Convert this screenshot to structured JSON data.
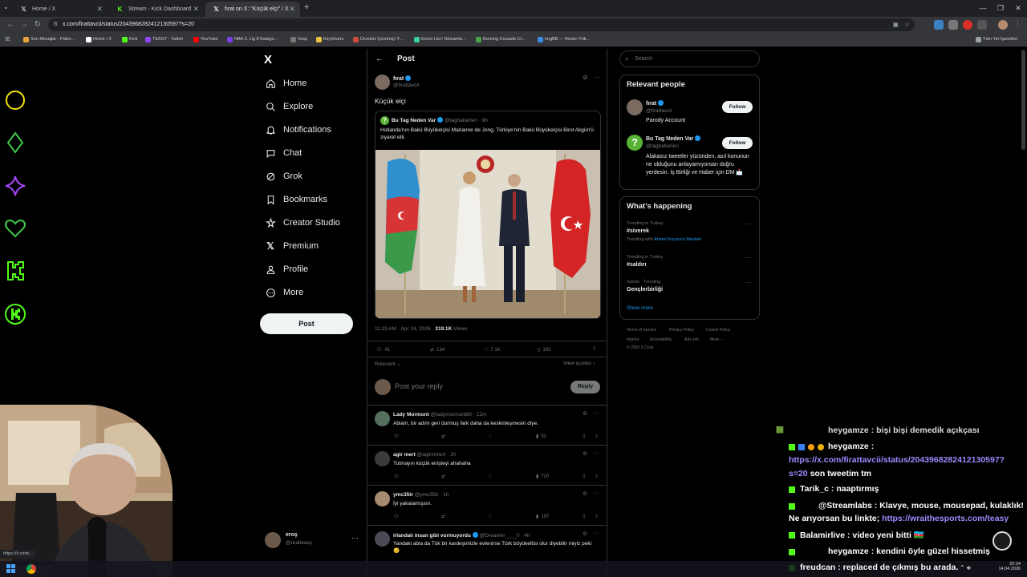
{
  "browser": {
    "tabs": [
      {
        "title": "Home / X",
        "icon": "x-logo-icon",
        "active": false
      },
      {
        "title": "Stream - Kick Dashboard",
        "icon": "kick-icon",
        "active": false
      },
      {
        "title": "fırat on X: \"Küçük elçi\" / X",
        "icon": "x-logo-icon",
        "active": true
      }
    ],
    "new_tab": "+",
    "url": "x.com/firattavcii/status/2043968282412130597?s=20",
    "bookmarks": [
      {
        "label": "Son Mesajlar - Patici...",
        "color": "#e8a33c"
      },
      {
        "label": "Home / X",
        "color": "#ffffff"
      },
      {
        "label": "Kick",
        "color": "#53fc18"
      },
      {
        "label": "TEASY - Twitch",
        "color": "#9146ff"
      },
      {
        "label": "YouTube",
        "color": "#ff0000"
      },
      {
        "label": "NBA 3. Lig 8 Katego...",
        "color": "#7b3fe4"
      },
      {
        "label": "Vosp",
        "color": "#777777"
      },
      {
        "label": "KeyGivers",
        "color": "#e8c33c"
      },
      {
        "label": "Ücretsiz Çevrimiçi Y...",
        "color": "#d04a3a"
      },
      {
        "label": "Event List / Streamla...",
        "color": "#3ccf9a"
      },
      {
        "label": "Burning Crusade Cl...",
        "color": "#4aa34a"
      },
      {
        "label": "ImgBB — Resim Yük...",
        "color": "#3c8be8"
      }
    ],
    "all_bookmarks": "Tüm Yer İşaretleri"
  },
  "left_nav": {
    "logo": "X",
    "items": [
      {
        "label": "Home",
        "icon": "home-icon"
      },
      {
        "label": "Explore",
        "icon": "search-icon"
      },
      {
        "label": "Notifications",
        "icon": "bell-icon"
      },
      {
        "label": "Chat",
        "icon": "chat-icon"
      },
      {
        "label": "Grok",
        "icon": "grok-icon"
      },
      {
        "label": "Bookmarks",
        "icon": "bookmark-icon"
      },
      {
        "label": "Creator Studio",
        "icon": "creator-studio-icon"
      },
      {
        "label": "Premium",
        "icon": "x-premium-icon"
      },
      {
        "label": "Profile",
        "icon": "profile-icon"
      },
      {
        "label": "More",
        "icon": "more-circle-icon"
      }
    ],
    "post_button": "Post",
    "account": {
      "name": "eroş",
      "handle": "@realteasy"
    }
  },
  "post": {
    "header": "Post",
    "author": {
      "name": "fırat",
      "handle": "@firattavcii"
    },
    "text": "Küçük elçi",
    "quoted": {
      "author": "Bu Tag Neden Var",
      "handle": "@taghaberleri",
      "age": "· 9h",
      "text": "Hollanda'nın Bakü Büyükelçisi Marianne de Jong, Türkiye'nin Bakü Büyükelçisi Birol Akgün'ü ziyaret etti."
    },
    "timestamp": "11:23 AM · Apr 14, 2026 · ",
    "views_count": "319.1K",
    "views_label": " Views",
    "stats": {
      "replies": "41",
      "reposts": "134",
      "likes": "7.1K",
      "bookmarks": "183"
    },
    "sort": "Relevant",
    "view_quotes": "View quotes",
    "reply_placeholder": "Post your reply",
    "reply_button": "Reply"
  },
  "replies": [
    {
      "name": "Lady Mormont",
      "handle": "@ladymormont80 · 12m",
      "text": "Ablam, bir adım geri durmuş fark daha da keskinleşmesin diye.",
      "likes": "",
      "views": "52"
    },
    {
      "name": "agir mert",
      "handle": "@agirmmert · 2h",
      "text": "Tutmayın küçük enişteyi ahahaha",
      "likes": "",
      "views": "720"
    },
    {
      "name": "ymc35tr",
      "handle": "@ymc35tr · 1h",
      "text": "İyi yakalamışsın.",
      "likes": "",
      "views": "197"
    },
    {
      "name": "irlandalı insan gibi vurmuyordu",
      "handle": "@Dreamer____0 · 4h",
      "text": "Yandaki abla da Tük bir kardeşimizle evlenirse Türk büyükeltisi olur diyebilir miyiz peki😊",
      "likes": "",
      "views": ""
    }
  ],
  "right": {
    "search_placeholder": "Search",
    "relevant_title": "Relevant people",
    "people": [
      {
        "name": "fırat",
        "handle": "@firattavcii",
        "bio": "Parody Account",
        "follow": "Follow"
      },
      {
        "name": "Bu Tag Neden Var",
        "handle": "@taghaberleri",
        "bio": "Alakasız tweetler yüzünden, asıl konunun ne olduğunu anlayamıyorsan doğru yerdesin. İş Birliği ve Haber için DM 📩",
        "follow": "Follow"
      }
    ],
    "happening_title": "What’s happening",
    "trends": [
      {
        "meta": "Trending in Turkey",
        "name": "#siverek",
        "extra_prefix": "Trending with ",
        "extra_link": "Ahmet Koyuncu Mesleki"
      },
      {
        "meta": "Trending in Turkey",
        "name": "#saldırı",
        "extra_prefix": "",
        "extra_link": ""
      },
      {
        "meta": "Sports · Trending",
        "name": "Gençlerbirliği",
        "extra_prefix": "",
        "extra_link": ""
      }
    ],
    "show_more": "Show more",
    "footer": [
      "Terms of Service",
      "Privacy Policy",
      "Cookie Policy",
      "Imprint",
      "Accessibility",
      "Ads info",
      "More ···",
      "© 2026 X Corp."
    ]
  },
  "chat": [
    {
      "user": "heygamze",
      "msg": " : bişi bişi demedik açıkçası",
      "link": ""
    },
    {
      "user": "heygamze",
      "msg": " :",
      "link": ""
    },
    {
      "user": "",
      "msg": "",
      "link": "https://x.com/firattavcii/status/2043968282412130597?"
    },
    {
      "user": "",
      "msg": " son tweetim tm",
      "link": "s=20"
    },
    {
      "user": "Tarik_c",
      "msg": " : naaptırmış",
      "link": ""
    },
    {
      "user": "@Streamlabs",
      "msg": " : Klavye, mouse, mousepad, kulaklık!",
      "link": ""
    },
    {
      "user": "",
      "msg": "Ne arıyorsan bu linkte; ",
      "link": "https://wraithesports.com/teasy"
    },
    {
      "user": "Balamirlive",
      "msg": " : video yeni bitti 🇦🇿",
      "link": ""
    },
    {
      "user": "heygamze",
      "msg": " : kendini öyle güzel hissetmiş",
      "link": ""
    },
    {
      "user": "freudcan",
      "msg": " : replaced de çıkmış bu arada.",
      "link": ""
    }
  ],
  "taskbar": {
    "time": "20:34",
    "date": "14.04.2026",
    "status_url": "https://x.com/..."
  }
}
